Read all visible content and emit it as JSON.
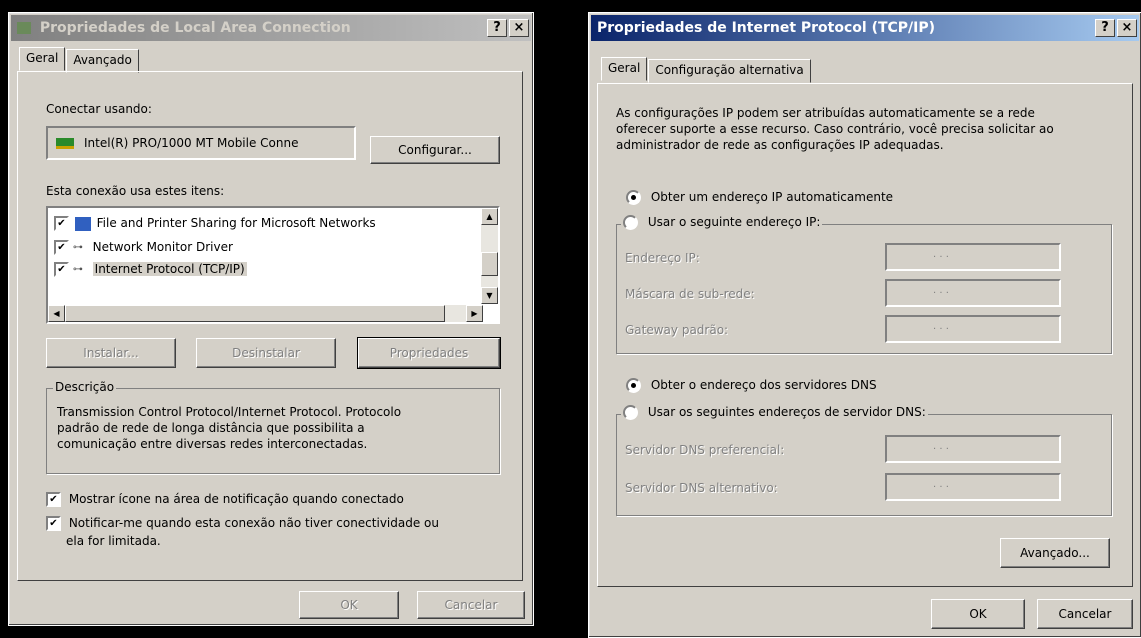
{
  "left": {
    "title": "Propriedades de Local Area Connection",
    "title_buttons": [
      "?",
      "×"
    ],
    "tabs": [
      "Geral",
      "Avançado"
    ],
    "connect_using_label": "Conectar usando:",
    "adapter": "Intel(R) PRO/1000 MT Mobile Conne",
    "configure_button": "Configurar...",
    "items_label": "Esta conexão usa estes itens:",
    "items": [
      {
        "label": "File and Printer Sharing for Microsoft Networks",
        "checked": true
      },
      {
        "label": "Network Monitor Driver",
        "checked": true
      },
      {
        "label": "Internet Protocol (TCP/IP)",
        "checked": true
      }
    ],
    "install_button": "Instalar...",
    "uninstall_button": "Desinstalar",
    "properties_button": "Propriedades",
    "description_title": "Descrição",
    "description_line1": "Transmission Control Protocol/Internet Protocol. Protocolo",
    "description_line2": "padrão de rede de longa distância que possibilita a",
    "description_line3": "comunicação entre diversas redes interconectadas.",
    "show_icon_checkbox": "Mostrar ícone na área de notificação quando conectado",
    "notify_checkbox_line1": "Notificar-me quando esta conexão não tiver conectividade ou",
    "notify_checkbox_line2": "ela for limitada.",
    "ok_button": "OK",
    "cancel_button": "Cancelar"
  },
  "right": {
    "title": "Propriedades de Internet Protocol (TCP/IP)",
    "title_buttons": [
      "?",
      "×"
    ],
    "tabs": [
      "Geral",
      "Configuração alternativa"
    ],
    "intro_line1": "As configurações IP podem ser atribuídas automaticamente se a rede",
    "intro_line2": "oferecer suporte a esse recurso. Caso contrário, você precisa solicitar ao",
    "intro_line3": "administrador de rede as configurações IP adequadas.",
    "auto_ip_radio": "Obter um endereço IP automaticamente",
    "manual_ip_radio": "Usar o seguinte endereço IP:",
    "ip_label": "Endereço IP:",
    "mask_label": "Máscara de sub-rede:",
    "gateway_label": "Gateway padrão:",
    "auto_dns_radio": "Obter o endereço dos servidores DNS",
    "manual_dns_radio": "Usar os seguintes endereços de servidor DNS:",
    "dns_preferred_label": "Servidor DNS preferencial:",
    "dns_alternate_label": "Servidor DNS alternativo:",
    "ip_field_dots": ".     .     .",
    "advanced_button": "Avançado...",
    "ok_button": "OK",
    "cancel_button": "Cancelar"
  },
  "colors": {
    "face": "#d4d0c8",
    "active_title": "#0a246a",
    "inactive_title": "#808080"
  }
}
